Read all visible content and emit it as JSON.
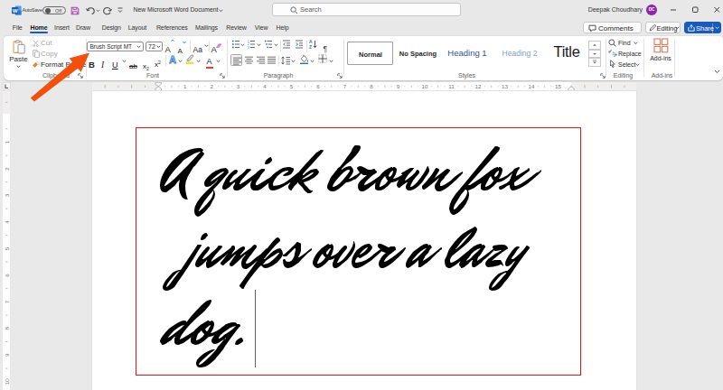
{
  "titlebar": {
    "autosave_label": "AutoSave",
    "autosave_state": "Off",
    "document_title": "New Microsoft Word Document",
    "search_placeholder": "Search",
    "user_name": "Deepak Choudhary",
    "user_initials": "DC"
  },
  "tabrow": {
    "tabs": [
      {
        "label": "File"
      },
      {
        "label": "Home"
      },
      {
        "label": "Insert"
      },
      {
        "label": "Draw"
      },
      {
        "label": "Design"
      },
      {
        "label": "Layout"
      },
      {
        "label": "References"
      },
      {
        "label": "Mailings"
      },
      {
        "label": "Review"
      },
      {
        "label": "View"
      },
      {
        "label": "Help"
      }
    ],
    "active_tab": "Home",
    "comments_label": "Comments",
    "editing_label": "Editing",
    "share_label": "Share"
  },
  "ribbon": {
    "clipboard": {
      "label": "Clipboard",
      "paste": "Paste",
      "cut": "Cut",
      "copy": "Copy",
      "format_painter": "Format Painter"
    },
    "font": {
      "label": "Font",
      "font_name": "Brush Script MT",
      "font_size": "72",
      "bold": "B",
      "italic": "I",
      "underline": "U",
      "change_case": "Aa",
      "grow": "A",
      "shrink": "A",
      "strike": "ab",
      "sub": "x",
      "sub_script": "2",
      "sup": "x",
      "sup_script": "2",
      "effects": "A",
      "color": "A",
      "clear": "A"
    },
    "paragraph": {
      "label": "Paragraph"
    },
    "styles": {
      "label": "Styles",
      "items": [
        {
          "name": "Normal"
        },
        {
          "name": "No Spacing"
        },
        {
          "name": "Heading 1"
        },
        {
          "name": "Heading 2"
        },
        {
          "name": "Title"
        }
      ],
      "selected": "Normal"
    },
    "editing": {
      "label": "Editing",
      "find": "Find",
      "replace": "Replace",
      "select": "Select"
    },
    "addins": {
      "label": "Add-ins",
      "button": "Add-ins"
    }
  },
  "ruler": {
    "horizontal_numbers": [
      1,
      2,
      3,
      4,
      5,
      6,
      7,
      8,
      9,
      10,
      11,
      12,
      13,
      14,
      15
    ],
    "vertical_numbers": [
      1,
      2,
      3,
      4,
      5,
      6,
      7,
      8,
      9,
      10
    ]
  },
  "document": {
    "text_lines": [
      "A quick brown fox",
      "jumps over a lazy",
      "dog."
    ],
    "text_font_name": "Brush Script MT",
    "annotation_box_color": "#ee1111"
  },
  "colors": {
    "accent": "#185abd",
    "arrow": "#f4500b",
    "avatar": "#8e2da8",
    "heading1": "#2f5496",
    "heading2": "#7f9fca"
  }
}
